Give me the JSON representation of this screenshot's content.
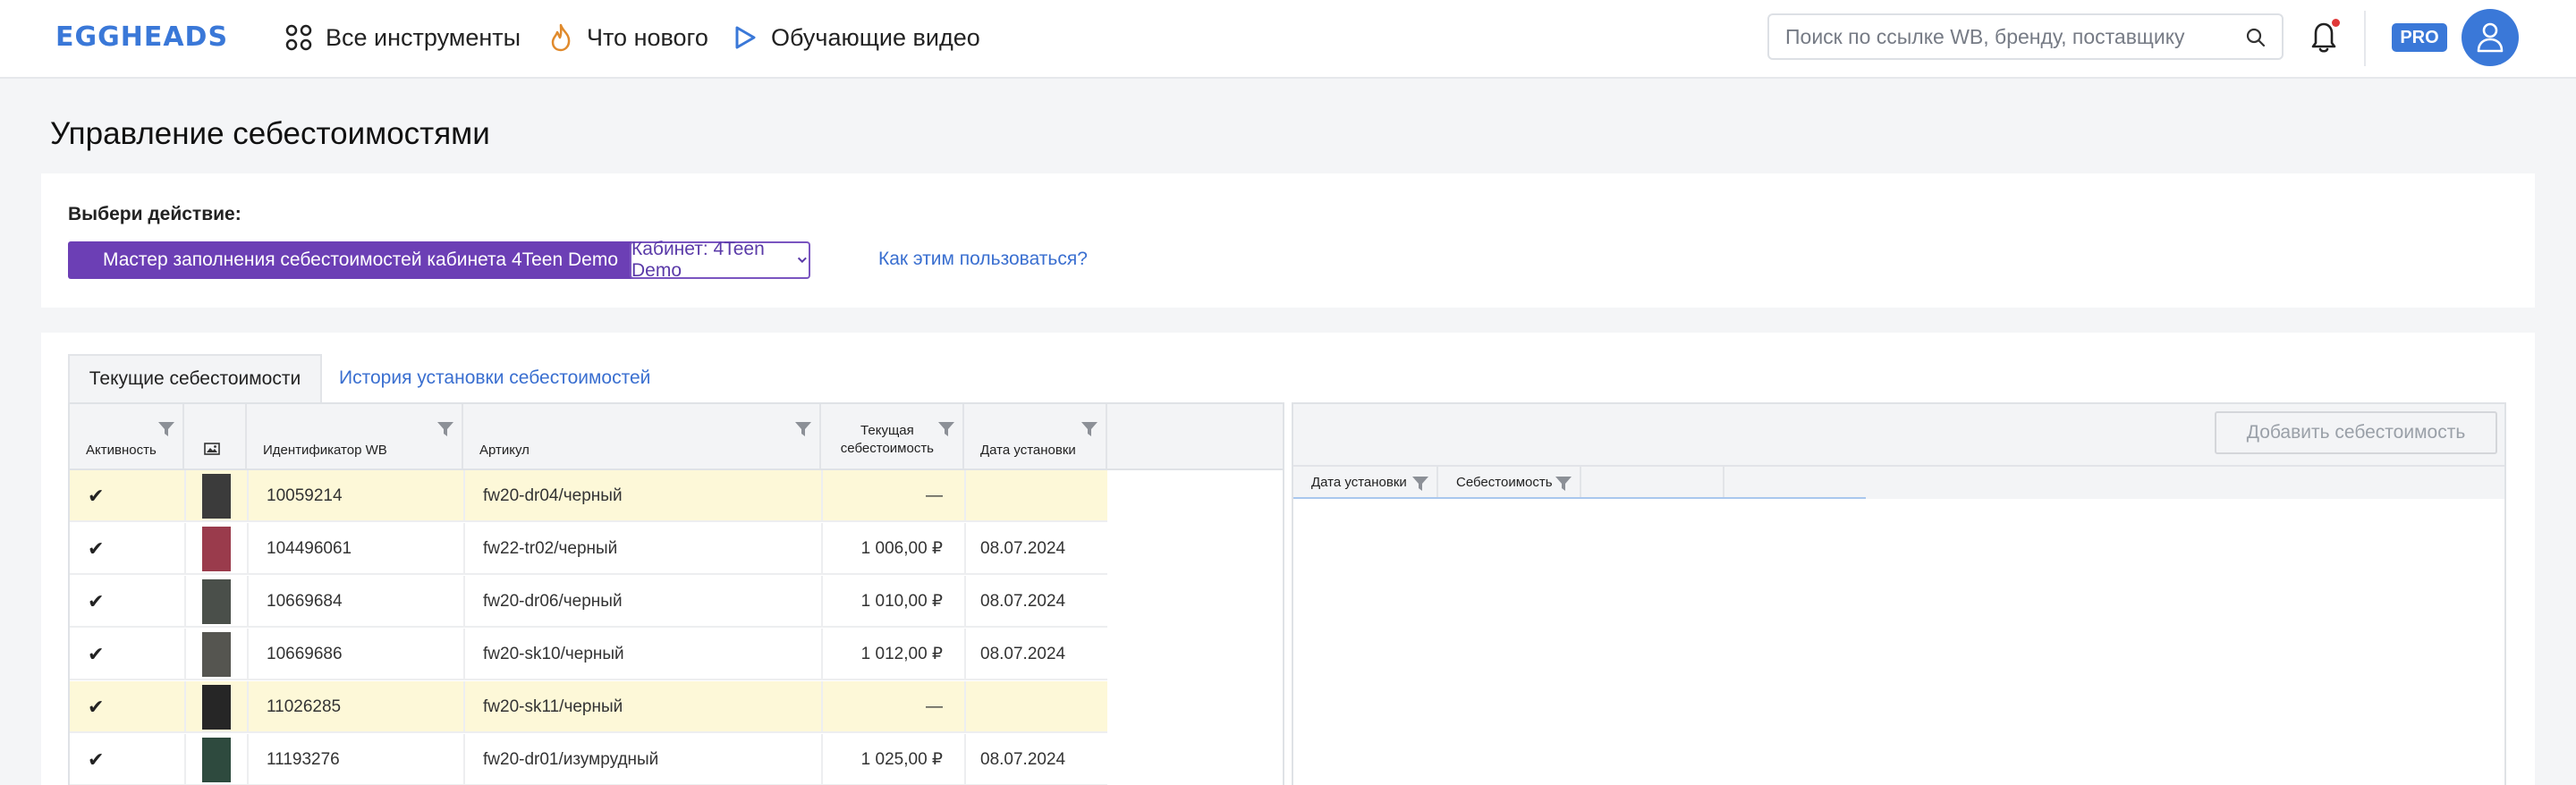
{
  "header": {
    "logo": "EGGHEADS",
    "nav": [
      {
        "label": "Все инструменты",
        "icon": "grid-icon"
      },
      {
        "label": "Что нового",
        "icon": "flame-icon"
      },
      {
        "label": "Обучающие видео",
        "icon": "play-icon"
      }
    ],
    "search_placeholder": "Поиск по ссылке WB, бренду, поставщику",
    "pro_badge": "PRO"
  },
  "page_title": "Управление себестоимостями",
  "actions": {
    "label": "Выбери действие:",
    "wizard_button": "Мастер заполнения себестоимостей кабинета 4Teen Demo",
    "cabinet_select": "Кабинет: 4Teen Demo",
    "howto_link": "Как этим пользоваться?"
  },
  "tabs": {
    "current": "Текущие себестоимости",
    "history": "История установки себестоимостей"
  },
  "left_table": {
    "columns": {
      "active": "Активность",
      "wb_id": "Идентификатор WB",
      "article": "Артикул",
      "cost_line1": "Текущая",
      "cost_line2": "себестоимость",
      "date": "Дата установки"
    },
    "rows": [
      {
        "check": "✔",
        "wb_id": "10059214",
        "article": "fw20-dr04/черный",
        "cost": "—",
        "date": "",
        "warn": true
      },
      {
        "check": "✔",
        "wb_id": "104496061",
        "article": "fw22-tr02/черный",
        "cost": "1 006,00 ₽",
        "date": "08.07.2024",
        "warn": false
      },
      {
        "check": "✔",
        "wb_id": "10669684",
        "article": "fw20-dr06/черный",
        "cost": "1 010,00 ₽",
        "date": "08.07.2024",
        "warn": false
      },
      {
        "check": "✔",
        "wb_id": "10669686",
        "article": "fw20-sk10/черный",
        "cost": "1 012,00 ₽",
        "date": "08.07.2024",
        "warn": false
      },
      {
        "check": "✔",
        "wb_id": "11026285",
        "article": "fw20-sk11/черный",
        "cost": "—",
        "date": "",
        "warn": true
      },
      {
        "check": "✔",
        "wb_id": "11193276",
        "article": "fw20-dr01/изумрудный",
        "cost": "1 025,00 ₽",
        "date": "08.07.2024",
        "warn": false
      }
    ]
  },
  "right_table": {
    "add_button": "Добавить себестоимость",
    "columns": {
      "date": "Дата установки",
      "cost": "Себестоимость"
    }
  },
  "colors": {
    "brand": "#3a78d8",
    "wizard": "#6c3fb5",
    "link": "#3a6fd0",
    "warn_row": "#fdf8d8"
  }
}
